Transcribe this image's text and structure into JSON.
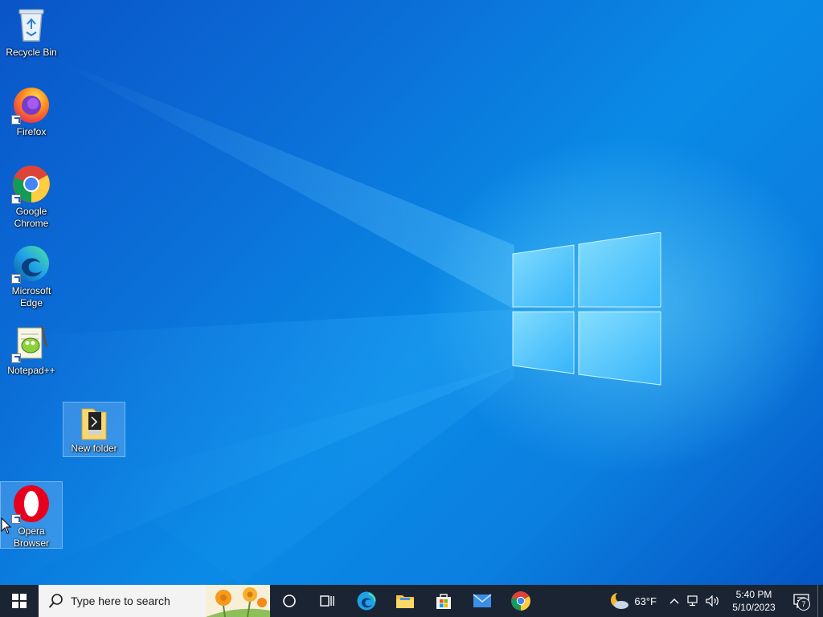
{
  "desktop": {
    "icons": [
      {
        "id": "recycle-bin",
        "label": "Recycle Bin",
        "icon": "recycle-bin-icon"
      },
      {
        "id": "firefox",
        "label": "Firefox",
        "icon": "firefox-icon"
      },
      {
        "id": "chrome",
        "label": "Google Chrome",
        "icon": "chrome-icon"
      },
      {
        "id": "edge",
        "label": "Microsoft Edge",
        "icon": "edge-icon"
      },
      {
        "id": "notepadpp",
        "label": "Notepad++",
        "icon": "notepadpp-icon"
      },
      {
        "id": "new-folder",
        "label": "New folder",
        "icon": "folder-icon"
      },
      {
        "id": "opera",
        "label": "Opera Browser",
        "icon": "opera-icon"
      }
    ]
  },
  "taskbar": {
    "search_placeholder": "Type here to search",
    "pinned": [
      "cortana-icon",
      "task-view-icon",
      "edge-icon",
      "file-explorer-icon",
      "microsoft-store-icon",
      "mail-icon",
      "chrome-icon"
    ]
  },
  "tray": {
    "temperature": "63°F",
    "time": "5:40 PM",
    "date": "5/10/2023",
    "notification_count": "7"
  },
  "colors": {
    "taskbar_bg": "#1a2433",
    "wallpaper_accent": "#0a8ae6"
  }
}
